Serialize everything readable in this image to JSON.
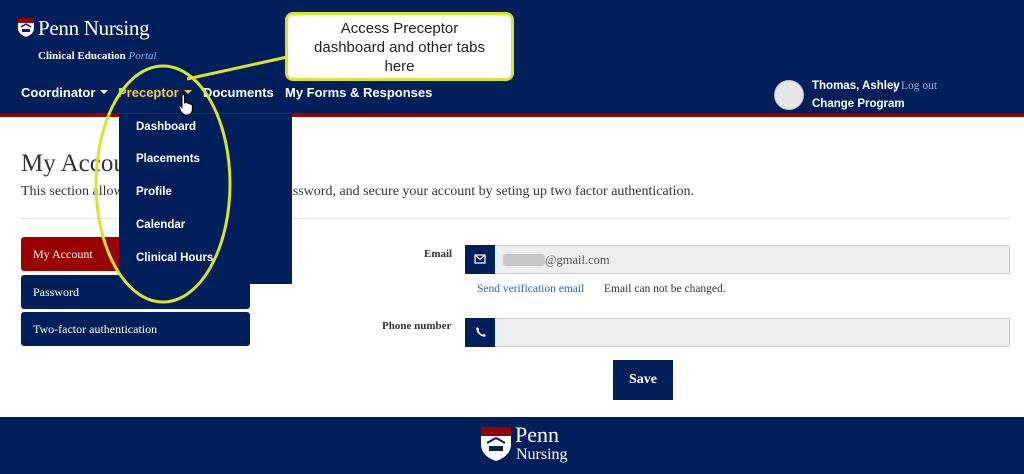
{
  "header": {
    "brand": "Penn Nursing",
    "subtitle": "Clinical Education",
    "subtitle_portal": "Portal"
  },
  "nav": {
    "items": [
      {
        "label": "Coordinator",
        "has_caret": true
      },
      {
        "label": "Preceptor",
        "has_caret": true,
        "active": true
      },
      {
        "label": "Documents",
        "has_caret": false
      },
      {
        "label": "My Forms & Responses",
        "has_caret": false
      }
    ]
  },
  "dropdown": {
    "items": [
      "Dashboard",
      "Placements",
      "Profile",
      "Calendar",
      "Clinical Hours"
    ]
  },
  "user": {
    "name": "Thomas, Ashley",
    "separator": "|",
    "logout": "Log out",
    "change_program": "Change Program"
  },
  "page": {
    "title": "My Account",
    "description": "This section allows you to update your email, password, and secure your account by seting up two factor authentication."
  },
  "side_tabs": [
    {
      "label": "My Account",
      "active": true
    },
    {
      "label": "Password",
      "active": false
    },
    {
      "label": "Two-factor authentication",
      "active": false
    }
  ],
  "form": {
    "email_label": "Email",
    "email_value": "@gmail.com",
    "verify_link": "Send verification email",
    "email_note": "Email can not be changed.",
    "phone_label": "Phone number",
    "phone_value": "",
    "save_label": "Save"
  },
  "footer": {
    "brand_top": "Penn",
    "brand_bottom": "Nursing"
  },
  "annotation": {
    "callout_lines": [
      "Access Preceptor",
      "dashboard and other tabs",
      "here"
    ]
  },
  "colors": {
    "navy": "#011f5b",
    "penn_red": "#990000",
    "active_nav": "#f2c94c",
    "callout_highlight": "#d8e52a",
    "link": "#2a64ad"
  },
  "icons": {
    "email_addon": "envelope-icon",
    "phone_addon": "phone-icon",
    "logo": "penn-shield-icon"
  }
}
